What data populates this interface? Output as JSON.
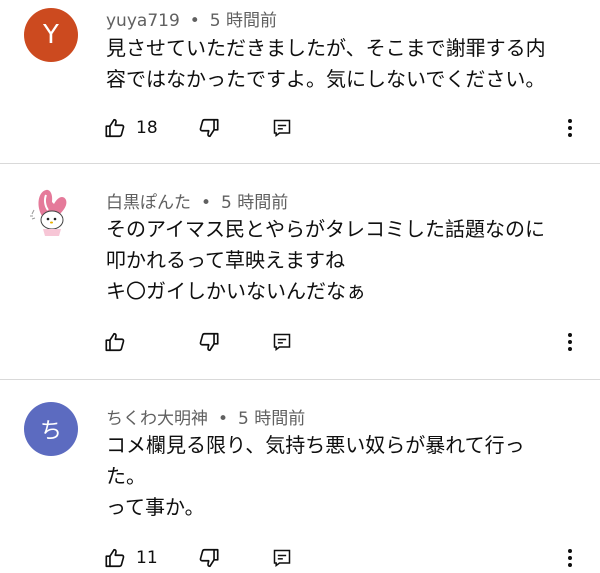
{
  "comments": [
    {
      "author": "yuya719",
      "time": "5 時間前",
      "separator": "•",
      "avatar_letter": "Y",
      "avatar_color": "#cc4a1f",
      "lines": [
        "見させていただきましたが、そこまで謝罪する内",
        "容ではなかったですよ。気にしないでください。"
      ],
      "likes": "18"
    },
    {
      "author": "白黒ぽんた",
      "time": "5 時間前",
      "separator": "•",
      "avatar_icon": "rabbit-character-icon",
      "lines": [
        "そのアイマス民とやらがタレコミした話題なのに",
        "叩かれるって草映えますね",
        "キ〇ガイしかいないんだなぁ"
      ],
      "likes": ""
    },
    {
      "author": "ちくわ大明神",
      "time": "5 時間前",
      "separator": "•",
      "avatar_letter": "ち",
      "avatar_color": "#5c6bc0",
      "lines": [
        "コメ欄見る限り、気持ち悪い奴らが暴れて行っ",
        "た。",
        "って事か。"
      ],
      "likes": "11"
    }
  ],
  "icons": {
    "like": "thumbs-up-icon",
    "dislike": "thumbs-down-icon",
    "reply": "reply-icon",
    "more": "more-vertical-icon"
  }
}
